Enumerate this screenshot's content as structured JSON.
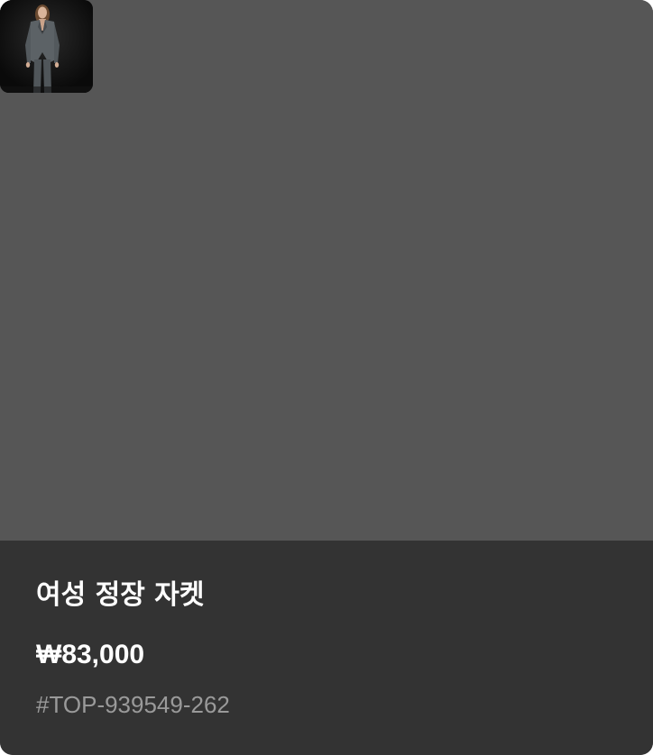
{
  "product": {
    "name": "여성 정장 자켓",
    "price": "₩83,000",
    "sku": "#TOP-939549-262",
    "thumbnail_icon": "product-photo-woman-gray-suit"
  },
  "colors": {
    "image_background": "#565656",
    "info_background": "#333333",
    "title_text": "#ffffff",
    "price_text": "#ffffff",
    "sku_text": "#9a9a9a"
  }
}
